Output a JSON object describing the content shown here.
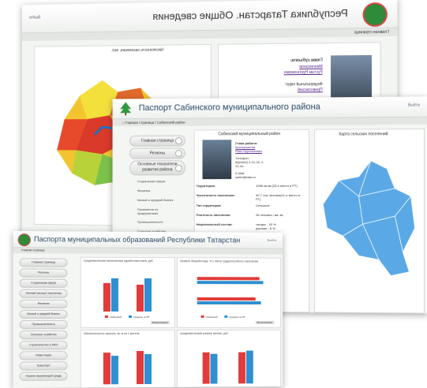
{
  "back_window": {
    "title": "Республика Татарстан. Общие сведения",
    "exit": "Выйти",
    "breadcrumb": "Главная страница",
    "map_title": "Численность населения, чел.",
    "head_title": "Глава субъекта:",
    "head_link1": "Минниханов",
    "head_link2": "Рустам Нургалиевич",
    "federal_district": "Федеральный округ:",
    "federal_link": "Приволжский"
  },
  "middle_window": {
    "title": "Паспорт Сабинского муниципального района",
    "exit": "Выйти",
    "breadcrumb": "Главная страница / Сабинский район",
    "nav": {
      "home": "Главная страница",
      "region": "Регионы",
      "indicators": "Основные показатели развития района",
      "sub": [
        "Социальная сфера",
        "Финансы",
        "Малый и средний бизнес",
        "Показатели по предприятиям",
        "Промышленность",
        "Сельское хозяйство"
      ]
    },
    "info_title": "Сабинский муниципальный район",
    "head_label": "Глава района:",
    "head_link1": "Миннахметов",
    "head_link2": "Раис Нургалиевич",
    "phone_label": "Телефон:",
    "phone": "8(84362) 2-31-33, 2-31-44",
    "email_label": "E-Mail",
    "email": "sabix@tatar.ru",
    "rows": [
      {
        "k": "Территория:",
        "v": "1098 кв.км.(33-е место в РТ)"
      },
      {
        "k": "Численность населения:",
        "v": "30,7 тыс.человек(11-е место в РТ)"
      },
      {
        "k": "Тип территории",
        "v": "Сельское"
      },
      {
        "k": "Плотность населения",
        "v": "28 человек / км. кв."
      },
      {
        "k": "Национальный состав:",
        "v": "татары - 93 %\nрусские - 6 %"
      }
    ],
    "extra_right": [
      "ности - 1%",
      "бы (Саба)"
    ],
    "map_title": "Карта сельских поселений"
  },
  "front_window": {
    "title": "Паспорта муниципальных образований Республики Татарстан",
    "exit": "Выйти",
    "breadcrumb": "Главная страница",
    "nav": [
      "Главная страница",
      "Регионы",
      "Социальная сфера",
      "Личный паспорт поселения",
      "Финансы",
      "Малый и средний бизнес",
      "Промышленность",
      "Сельское хозяйство",
      "Строительство и ЖКХ",
      "Инвестиции",
      "Транспорт",
      "Охрана окружающей среды"
    ],
    "panel_titles": [
      "Среднемесячная начисленная заработная плата, руб.",
      "Уровень безработицы, % к числу трудоспособного населения",
      "Обеспеченность жильем, кв. м на 1 жителя",
      "Среднемесячный размер пенсии, руб."
    ],
    "legend": [
      "Сабинский",
      "Среднее по РТ"
    ],
    "chart_button": "Визуализация",
    "colors": {
      "red": "#e23b3b",
      "blue": "#2f8fd0"
    }
  }
}
